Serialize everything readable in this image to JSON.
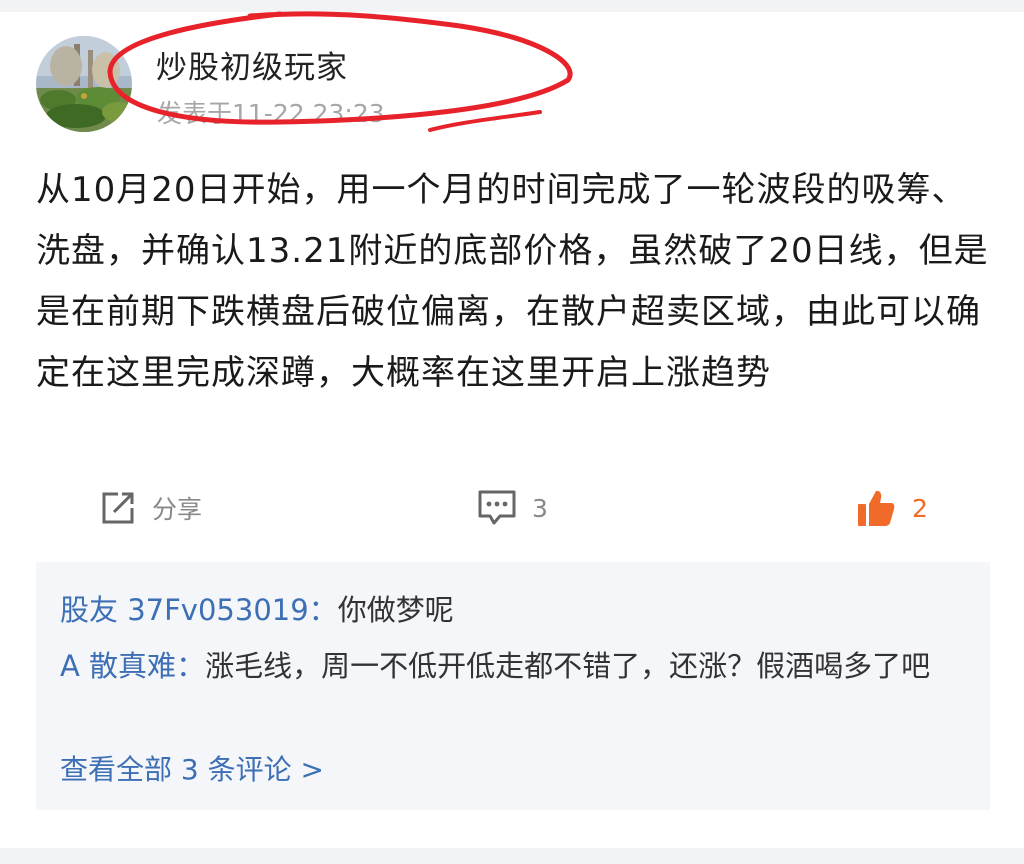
{
  "post": {
    "author": "炒股初级玩家",
    "timestamp": "发表于11-22 23:23",
    "body": "从10月20日开始，用一个月的时间完成了一轮波段的吸筹、洗盘，并确认13.21附近的底部价格，虽然破了20日线，但是是在前期下跌横盘后破位偏离，在散户超卖区域，由此可以确定在这里完成深蹲，大概率在这里开启上涨趋势"
  },
  "actions": {
    "share_label": "分享",
    "comment_count": "3",
    "like_count": "2"
  },
  "comments": [
    {
      "author": "股友 37Fv053019",
      "separator": "：",
      "text": "你做梦呢"
    },
    {
      "author": "A 散真难",
      "separator": "：",
      "text": "涨毛线，周一不低开低走都不错了，还涨？假酒喝多了吧"
    }
  ],
  "view_all_label": "查看全部 3 条评论 >",
  "colors": {
    "link_blue": "#3d6fb4",
    "like_orange": "#f06a2a",
    "annotation_red": "#e8222a",
    "comment_bg": "#f4f6fa"
  },
  "icons": [
    "share-icon",
    "comment-icon",
    "thumbs-up-icon"
  ]
}
